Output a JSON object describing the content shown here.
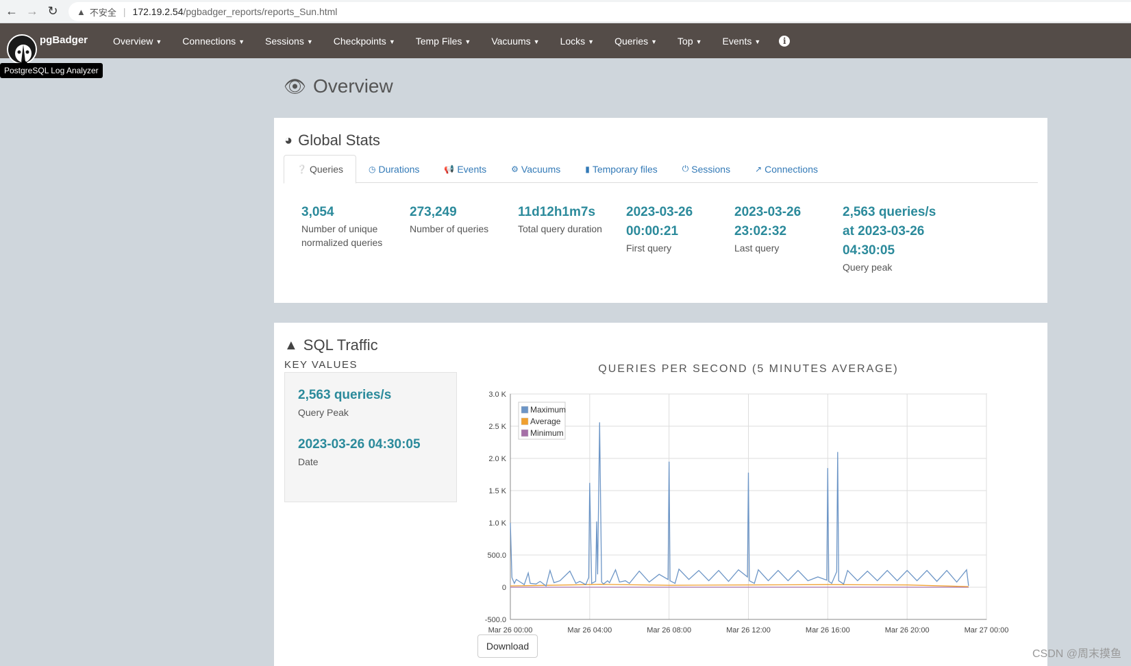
{
  "browser": {
    "insecure_label": "不安全",
    "url_host": "172.19.2.54",
    "url_path": "/pgbadger_reports/reports_Sun.html"
  },
  "navbar": {
    "brand": "pgBadger",
    "tooltip": "PostgreSQL Log Analyzer",
    "menu": [
      "Overview",
      "Connections",
      "Sessions",
      "Checkpoints",
      "Temp Files",
      "Vacuums",
      "Locks",
      "Queries",
      "Top",
      "Events"
    ]
  },
  "page": {
    "title": "Overview"
  },
  "global_stats": {
    "title": "Global Stats",
    "tabs": [
      "Queries",
      "Durations",
      "Events",
      "Vacuums",
      "Temporary files",
      "Sessions",
      "Connections"
    ],
    "stats": [
      {
        "value": "3,054",
        "label": "Number of unique normalized queries"
      },
      {
        "value": "273,249",
        "label": "Number of queries"
      },
      {
        "value": "11d12h1m7s",
        "label": "Total query duration"
      },
      {
        "value": "2023-03-26 00:00:21",
        "label": "First query"
      },
      {
        "value": "2023-03-26 23:02:32",
        "label": "Last query"
      },
      {
        "value": "2,563 queries/s at 2023-03-26 04:30:05",
        "label": "Query peak"
      }
    ]
  },
  "sql_traffic": {
    "title": "SQL Traffic",
    "key_values_title": "KEY VALUES",
    "peak_value": "2,563 queries/s",
    "peak_label": "Query Peak",
    "date_value": "2023-03-26 04:30:05",
    "date_label": "Date",
    "download_label": "Download"
  },
  "chart_data": {
    "type": "line",
    "title": "QUERIES PER SECOND (5 MINUTES AVERAGE)",
    "xlabel": "",
    "ylabel": "",
    "ylim": [
      -500,
      3000
    ],
    "yticks": [
      "-500.0",
      "0",
      "500.0",
      "1.0 K",
      "1.5 K",
      "2.0 K",
      "2.5 K",
      "3.0 K"
    ],
    "xticks": [
      "Mar 26 00:00",
      "Mar 26 04:00",
      "Mar 26 08:00",
      "Mar 26 12:00",
      "Mar 26 16:00",
      "Mar 26 20:00",
      "Mar 27 00:00"
    ],
    "xlim_hours": [
      0,
      24
    ],
    "legend_position": "top-left",
    "grid": true,
    "series": [
      {
        "name": "Maximum",
        "color": "#6c95c6",
        "x": [
          0,
          0.08,
          0.2,
          0.3,
          0.5,
          0.7,
          0.9,
          1.0,
          1.3,
          1.5,
          1.8,
          2.0,
          2.2,
          2.5,
          3.0,
          3.3,
          3.5,
          3.8,
          3.95,
          4.0,
          4.1,
          4.3,
          4.35,
          4.4,
          4.5,
          4.6,
          4.7,
          4.9,
          5.0,
          5.3,
          5.5,
          5.8,
          6.0,
          6.5,
          7.0,
          7.5,
          7.95,
          8.0,
          8.05,
          8.3,
          8.5,
          9.0,
          9.5,
          10.0,
          10.5,
          11.0,
          11.5,
          11.95,
          12.0,
          12.05,
          12.3,
          12.5,
          13.0,
          13.5,
          14.0,
          14.5,
          15.0,
          15.5,
          15.95,
          16.0,
          16.05,
          16.2,
          16.45,
          16.5,
          16.55,
          16.8,
          17.0,
          17.5,
          18.0,
          18.5,
          19.0,
          19.5,
          20.0,
          20.5,
          21.0,
          21.5,
          22.0,
          22.5,
          23.0,
          23.1
        ],
        "y": [
          1000,
          150,
          60,
          120,
          80,
          40,
          220,
          60,
          50,
          90,
          20,
          260,
          70,
          100,
          250,
          60,
          90,
          40,
          150,
          1620,
          60,
          90,
          1020,
          200,
          2560,
          80,
          50,
          100,
          70,
          270,
          80,
          100,
          60,
          250,
          80,
          200,
          120,
          1950,
          100,
          60,
          280,
          120,
          260,
          100,
          260,
          90,
          270,
          160,
          1780,
          100,
          60,
          270,
          100,
          260,
          100,
          260,
          100,
          160,
          110,
          1850,
          90,
          60,
          240,
          2100,
          100,
          50,
          260,
          100,
          250,
          100,
          260,
          100,
          260,
          100,
          260,
          90,
          260,
          80,
          270,
          20
        ]
      },
      {
        "name": "Average",
        "color": "#f0a030",
        "x": [
          0,
          4.0,
          4.5,
          8.0,
          12.0,
          16.0,
          20.0,
          23.1
        ],
        "y": [
          20,
          40,
          45,
          30,
          35,
          40,
          35,
          10
        ]
      },
      {
        "name": "Minimum",
        "color": "#a56fa7",
        "x": [
          0,
          23.1
        ],
        "y": [
          0,
          0
        ]
      }
    ]
  },
  "watermark": "CSDN @周末摸鱼"
}
